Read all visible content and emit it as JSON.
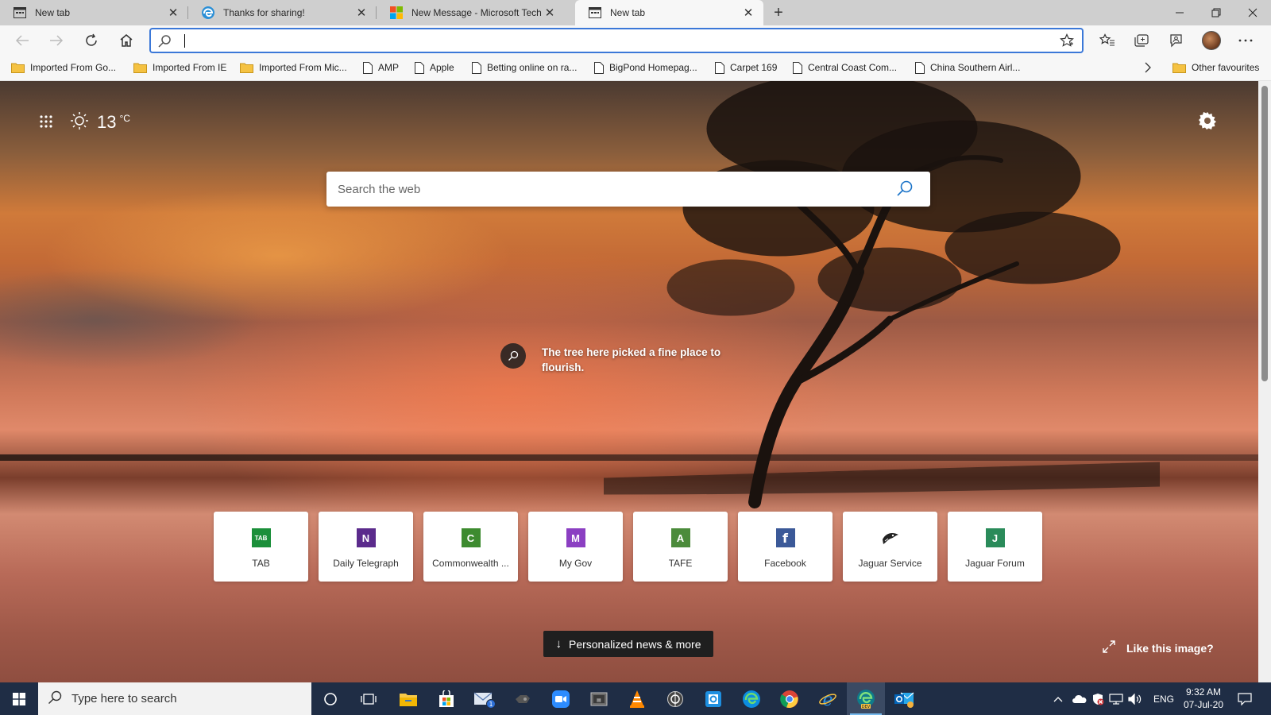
{
  "tabs": [
    {
      "label": "New tab",
      "icon": "page-icon"
    },
    {
      "label": "Thanks for sharing!",
      "icon": "edge-icon"
    },
    {
      "label": "New Message - Microsoft Tech C",
      "icon": "microsoft-icon"
    },
    {
      "label": "New tab",
      "icon": "page-icon",
      "active": true
    }
  ],
  "address": {
    "value": "",
    "placeholder": ""
  },
  "favorites": [
    {
      "label": "Imported From Go...",
      "type": "folder"
    },
    {
      "label": "Imported From IE",
      "type": "folder"
    },
    {
      "label": "Imported From Mic...",
      "type": "folder"
    },
    {
      "label": "AMP",
      "type": "page"
    },
    {
      "label": "Apple",
      "type": "page"
    },
    {
      "label": "Betting online on ra...",
      "type": "page"
    },
    {
      "label": "BigPond Homepag...",
      "type": "page"
    },
    {
      "label": "Carpet 169",
      "type": "page"
    },
    {
      "label": "Central Coast Com...",
      "type": "page"
    },
    {
      "label": "China Southern Airl...",
      "type": "page"
    }
  ],
  "other_favourites": "Other favourites",
  "weather": {
    "temp": "13",
    "unit": "°C"
  },
  "search": {
    "placeholder": "Search the web"
  },
  "caption": "The tree here picked a fine place to flourish.",
  "tiles": [
    {
      "label": "TAB",
      "glyph": "TAB",
      "color": "#1b8f3a"
    },
    {
      "label": "Daily Telegraph",
      "glyph": "N",
      "color": "#5b2b8c"
    },
    {
      "label": "Commonwealth ...",
      "glyph": "C",
      "color": "#3d8b2f"
    },
    {
      "label": "My Gov",
      "glyph": "M",
      "color": "#8b3fc2"
    },
    {
      "label": "TAFE",
      "glyph": "A",
      "color": "#4b8b3b"
    },
    {
      "label": "Facebook",
      "glyph": "f",
      "color": "#3b5998"
    },
    {
      "label": "Jaguar Service",
      "glyph": "",
      "color": "#222222"
    },
    {
      "label": "Jaguar Forum",
      "glyph": "J",
      "color": "#2a8b5a"
    }
  ],
  "news_button": "Personalized news & more",
  "like_image": "Like this image?",
  "taskbar": {
    "search_placeholder": "Type here to search",
    "language": "ENG",
    "time": "9:32 AM",
    "date": "07-Jul-20",
    "mail_badge": "1"
  },
  "colors": {
    "accent": "#3b78d8",
    "taskbar": "#1f2d45"
  }
}
